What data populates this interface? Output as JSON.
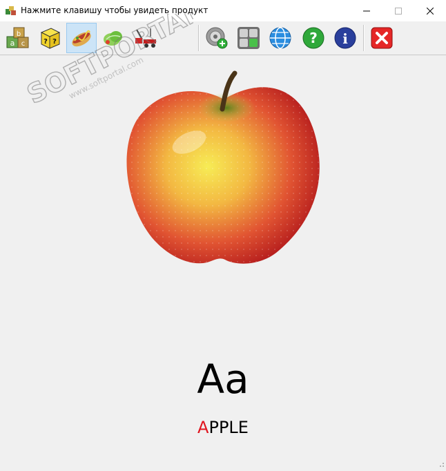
{
  "window": {
    "title": "Нажмите клавишу чтобы увидеть продукт"
  },
  "toolbar": {
    "buttons": [
      {
        "name": "abc-blocks",
        "icon": "abc-blocks-icon",
        "selected": false
      },
      {
        "name": "question-box",
        "icon": "question-box-icon",
        "selected": false
      },
      {
        "name": "food",
        "icon": "hotdog-icon",
        "selected": true
      },
      {
        "name": "vegetables",
        "icon": "vegetables-icon",
        "selected": false
      },
      {
        "name": "toys",
        "icon": "toy-wagon-icon",
        "selected": false
      },
      {
        "name": "add-sound",
        "icon": "speaker-add-icon",
        "selected": false
      },
      {
        "name": "keyboard",
        "icon": "keyboard-icon",
        "selected": false
      },
      {
        "name": "web",
        "icon": "globe-icon",
        "selected": false
      },
      {
        "name": "help",
        "icon": "help-icon",
        "selected": false
      },
      {
        "name": "about",
        "icon": "info-icon",
        "selected": false
      },
      {
        "name": "exit",
        "icon": "close-red-icon",
        "selected": false
      }
    ]
  },
  "watermark": {
    "brand": "SOFTPORTAL",
    "url": "www.softportal.com"
  },
  "product": {
    "image": "apple",
    "letters": "Aa",
    "word_first": "A",
    "word_rest": "PPLE"
  },
  "colors": {
    "accent_letter": "#e0141e",
    "selected_bg": "#cce4f7"
  }
}
